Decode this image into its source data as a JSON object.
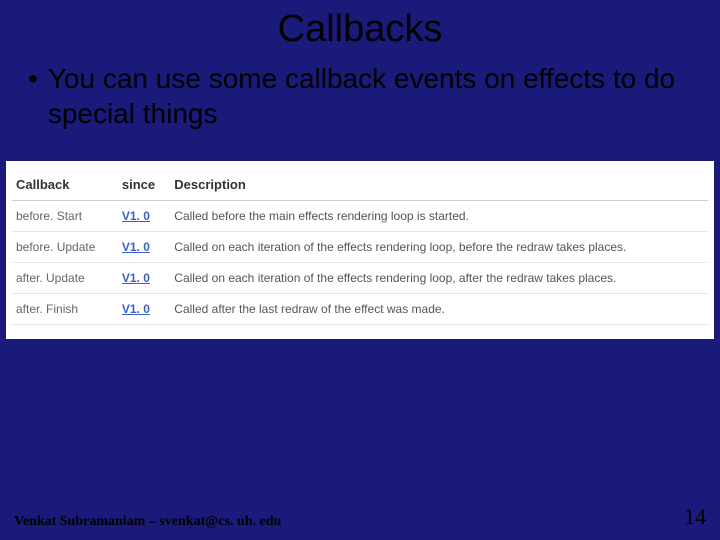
{
  "title": "Callbacks",
  "bullet": "You can use some callback events on effects to do special things",
  "table": {
    "headers": {
      "callback": "Callback",
      "since": "since",
      "description": "Description"
    },
    "rows": [
      {
        "name": "before. Start",
        "since": "V1. 0",
        "desc": "Called before the main effects rendering loop is started."
      },
      {
        "name": "before. Update",
        "since": "V1. 0",
        "desc": "Called on each iteration of the effects rendering loop, before the redraw takes places."
      },
      {
        "name": "after. Update",
        "since": "V1. 0",
        "desc": "Called on each iteration of the effects rendering loop, after the redraw takes places."
      },
      {
        "name": "after. Finish",
        "since": "V1. 0",
        "desc": "Called after the last redraw of the effect was made."
      }
    ]
  },
  "footer": {
    "author": "Venkat Subramaniam – svenkat@cs. uh. edu",
    "page": "14"
  }
}
